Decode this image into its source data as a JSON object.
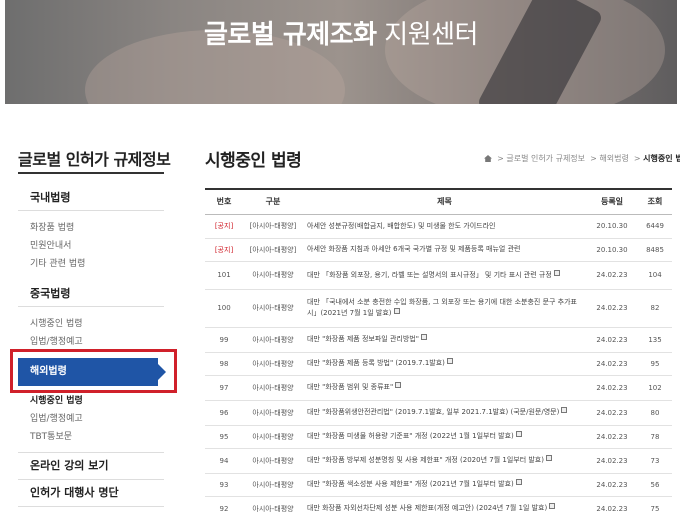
{
  "banner": {
    "title_bold": "글로벌 규제조화",
    "title_light": "지원센터"
  },
  "sidebar": {
    "title": "글로벌 인허가 규제정보",
    "groups": [
      {
        "head": "국내법령",
        "subs": [
          "화장품 법령",
          "민원안내서",
          "기타 관련 법령"
        ]
      },
      {
        "head": "중국법령",
        "subs": [
          "시행중인 법령",
          "입법/행정예고"
        ]
      },
      {
        "head": "해외법령",
        "active": true,
        "subs": [
          "시행중인 법령",
          "입법/행정예고",
          "TBT통보문"
        ]
      },
      {
        "head": "온라인 강의 보기",
        "subs": []
      },
      {
        "head": "인허가 대행사 명단",
        "subs": []
      }
    ]
  },
  "main": {
    "title": "시행중인 법령",
    "breadcrumb": [
      "글로벌 인허가 규제정보",
      "해외법령",
      "시행중인 법령"
    ],
    "table": {
      "headers": [
        "번호",
        "구분",
        "제목",
        "등록일",
        "조회"
      ],
      "rows": [
        {
          "no": "[공지]",
          "notice": true,
          "cat": "[아시아-태평양]",
          "title": "아세안 성분규정(배합금지, 배합한도) 및 미생물 한도 가이드라인",
          "date": "20.10.30",
          "views": "6449",
          "badge": false
        },
        {
          "no": "[공지]",
          "notice": true,
          "cat": "[아시아-태평양]",
          "title": "아세안 화장품 지침과 아세안 6개국 국가별 규정 및 제품등록 매뉴얼 관련",
          "date": "20.10.30",
          "views": "8485",
          "badge": false
        },
        {
          "no": "101",
          "cat": "아시아-태평양",
          "title": "대만 「화장품 외포장, 용기, 라벨 또는 설명서의 표시규정」 및 기타 표시 관련 규정",
          "date": "24.02.23",
          "views": "104",
          "badge": true
        },
        {
          "no": "100",
          "cat": "아시아-태평양",
          "title": "대만 「국내에서 소분 충전한 수입 화장품, 그 외포장 또는 용기에 대한 소분충진 문구 추가표시」(2021년 7월 1일 발효)",
          "date": "24.02.23",
          "views": "82",
          "badge": true
        },
        {
          "no": "99",
          "cat": "아시아-태평양",
          "title": "대만 \"화장품 제품 정보파일 관리방법\"",
          "date": "24.02.23",
          "views": "135",
          "badge": true
        },
        {
          "no": "98",
          "cat": "아시아-태평양",
          "title": "대만 \"화장품 제품 등록 방법\" (2019.7.1발효)",
          "date": "24.02.23",
          "views": "95",
          "badge": true
        },
        {
          "no": "97",
          "cat": "아시아-태평양",
          "title": "대만 \"화장품 범위 및 종류표\"",
          "date": "24.02.23",
          "views": "102",
          "badge": true
        },
        {
          "no": "96",
          "cat": "아시아-태평양",
          "title": "대만 \"화장품위생안전관리법\" (2019.7.1발효, 일부 2021.7.1발효) (국문/원문/영문)",
          "date": "24.02.23",
          "views": "80",
          "badge": true
        },
        {
          "no": "95",
          "cat": "아시아-태평양",
          "title": "대만 \"화장품 미생물 허용량 기준표\" 개정 (2022년 1월 1일부터 발효)",
          "date": "24.02.23",
          "views": "78",
          "badge": true
        },
        {
          "no": "94",
          "cat": "아시아-태평양",
          "title": "대만 \"화장품 방부제 성분명칭 및 사용 제한표\" 개정 (2020년 7월 1일부터 발효)",
          "date": "24.02.23",
          "views": "73",
          "badge": true
        },
        {
          "no": "93",
          "cat": "아시아-태평양",
          "title": "대만 \"화장품 색소성분 사용 제한표\" 개정 (2021년 7월 1일부터 발효)",
          "date": "24.02.23",
          "views": "56",
          "badge": true
        },
        {
          "no": "92",
          "cat": "아시아-태평양",
          "title": "대만 화장품 자외선차단제 성분 사용 제한표(개정 예고안) (2024년 7월 1일 발효)",
          "date": "24.02.23",
          "views": "75",
          "badge": true
        }
      ]
    }
  }
}
